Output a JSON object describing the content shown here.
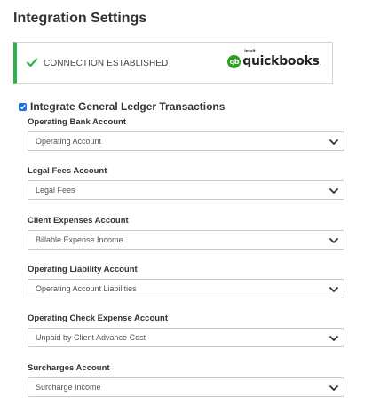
{
  "page": {
    "title": "Integration Settings"
  },
  "connection": {
    "status_text": "CONNECTION ESTABLISHED",
    "status_color": "#2db24c",
    "provider_logo": {
      "badge": "qb",
      "prefix": "intuit",
      "name": "quickbooks",
      "suffix": ".",
      "color": "#2ca01c"
    }
  },
  "gl": {
    "label": "Integrate General Ledger Transactions",
    "checked": true
  },
  "fields": [
    {
      "label": "Operating Bank Account",
      "value": "Operating Account"
    },
    {
      "label": "Legal Fees Account",
      "value": "Legal Fees"
    },
    {
      "label": "Client Expenses Account",
      "value": "Billable Expense Income"
    },
    {
      "label": "Operating Liability Account",
      "value": "Operating Account Liabilities"
    },
    {
      "label": "Operating Check Expense Account",
      "value": "Unpaid by Client Advance Cost"
    },
    {
      "label": "Surcharges Account",
      "value": "Surcharge Income"
    }
  ]
}
